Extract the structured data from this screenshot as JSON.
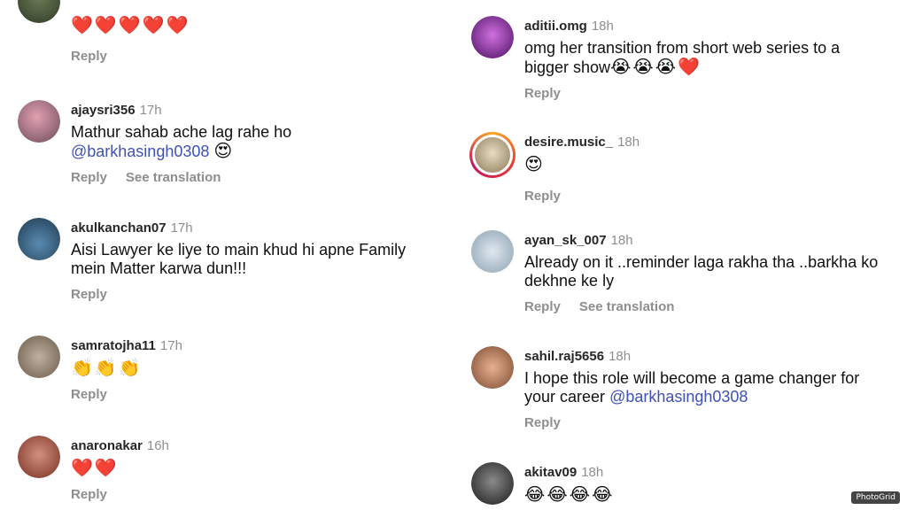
{
  "left_column": [
    {
      "username": "",
      "time": "",
      "text": "",
      "emoji": "❤️❤️❤️❤️❤️",
      "reply": "Reply",
      "translation": "",
      "avatar_color": "#4a5a3a",
      "story_ring": false
    },
    {
      "username": "ajaysri356",
      "time": "17h",
      "text": "Mathur sahab ache lag rahe ho",
      "mention": "@barkhasingh0308",
      "emoji": "😍",
      "reply": "Reply",
      "translation": "See translation",
      "avatar_color": "#b56b8a",
      "story_ring": false
    },
    {
      "username": "akulkanchan07",
      "time": "17h",
      "text": "Aisi Lawyer ke liye to main khud hi apne Family\nmein Matter karwa dun!!!",
      "reply": "Reply",
      "translation": "",
      "avatar_color": "#2e5b7a",
      "story_ring": false
    },
    {
      "username": "samratojha11",
      "time": "17h",
      "text": "",
      "emoji": "👏👏👏",
      "reply": "Reply",
      "translation": "",
      "avatar_color": "#8a7a6a",
      "story_ring": false
    },
    {
      "username": "anaronakar",
      "time": "16h",
      "text": "",
      "emoji": "❤️❤️",
      "reply": "Reply",
      "translation": "",
      "avatar_color": "#a05040",
      "story_ring": false
    }
  ],
  "right_column": [
    {
      "username": "aditii.omg",
      "time": "18h",
      "text": "omg her transition from short web series to a\nbigger show",
      "emoji": "😭😭😭❤️",
      "reply": "Reply",
      "translation": "",
      "avatar_color": "#7a2a8a",
      "story_ring": false
    },
    {
      "username": "desire.music_",
      "time": "18h",
      "text": "",
      "emoji": "😍",
      "reply": "Reply",
      "translation": "",
      "avatar_color": "#c9b48a",
      "story_ring": true
    },
    {
      "username": "ayan_sk_007",
      "time": "18h",
      "text": "Already on it ..reminder laga rakha tha ..barkha ko\ndekhne ke ly",
      "reply": "Reply",
      "translation": "See translation",
      "avatar_color": "#9ab0c0",
      "story_ring": false
    },
    {
      "username": "sahil.raj5656",
      "time": "18h",
      "text": "I hope this role will become a game changer for\nyour career",
      "mention": "@barkhasingh0308",
      "reply": "Reply",
      "translation": "",
      "avatar_color": "#b0785a",
      "story_ring": false
    },
    {
      "username": "akitav09",
      "time": "18h",
      "text": "",
      "emoji": "😂😂😂😂",
      "reply": "Reply",
      "translation": "",
      "avatar_color": "#3a3a3a",
      "story_ring": false
    }
  ],
  "watermark": "PhotoGrid"
}
